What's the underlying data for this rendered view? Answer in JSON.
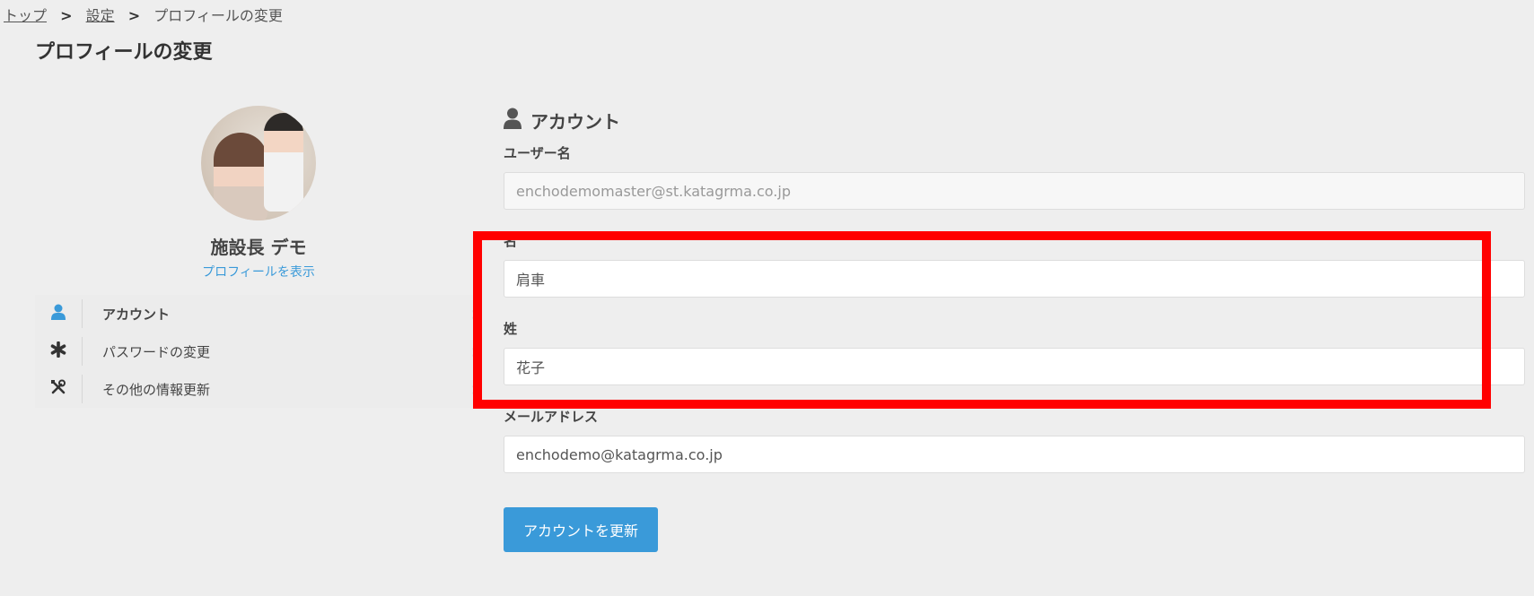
{
  "breadcrumb": {
    "home": "トップ",
    "settings": "設定",
    "current": "プロフィールの変更",
    "separator": ">"
  },
  "page": {
    "title": "プロフィールの変更"
  },
  "profile": {
    "name": "施設長 デモ",
    "view_link": "プロフィールを表示",
    "avatar_icon": "user-photo"
  },
  "menu": {
    "items": [
      {
        "label": "アカウント",
        "icon": "user-icon",
        "active": true
      },
      {
        "label": "パスワードの変更",
        "icon": "asterisk-icon",
        "active": false
      },
      {
        "label": "その他の情報更新",
        "icon": "tools-icon",
        "active": false
      }
    ],
    "chevron": "›"
  },
  "form": {
    "section_title": "アカウント",
    "section_icon": "user-icon",
    "username_label": "ユーザー名",
    "username_value": "enchodemomaster@st.katagrma.co.jp",
    "first_name_label": "名",
    "first_name_value": "肩車",
    "last_name_label": "姓",
    "last_name_value": "花子",
    "email_label": "メールアドレス",
    "email_value": "enchodemo@katagrma.co.jp",
    "submit_label": "アカウントを更新"
  },
  "colors": {
    "accent": "#3a9ad9",
    "highlight": "#ff0000",
    "background": "#eeeeee"
  }
}
